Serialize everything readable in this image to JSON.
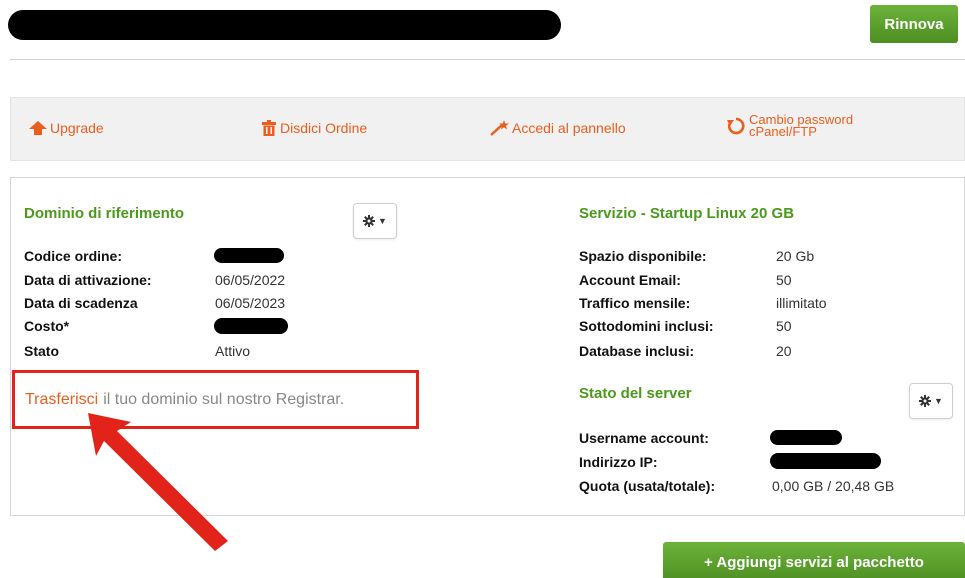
{
  "header": {
    "title_redacted": "redacted",
    "renew_label": "Rinnova"
  },
  "actions": {
    "upgrade": "Upgrade",
    "cancel_order": "Disdici Ordine",
    "panel_access": "Accedi al pannello",
    "password_line1": "Cambio password",
    "password_line2": "cPanel/FTP"
  },
  "domain_section": {
    "title": "Dominio di riferimento",
    "order_code_label": "Codice ordine:",
    "activation_label": "Data di attivazione:",
    "activation_value": "06/05/2022",
    "expiry_label": "Data di scadenza",
    "expiry_value": "06/05/2023",
    "cost_label": "Costo*",
    "status_label": "Stato",
    "status_value": "Attivo"
  },
  "transfer": {
    "link": "Trasferisci",
    "text": "il tuo dominio sul nostro Registrar."
  },
  "service_section": {
    "title": "Servizio - Startup Linux 20 GB",
    "rows": [
      {
        "label": "Spazio disponibile:",
        "value": "20 Gb"
      },
      {
        "label": "Account Email:",
        "value": "50"
      },
      {
        "label": "Traffico mensile:",
        "value": "illimitato"
      },
      {
        "label": "Sottodomini inclusi:",
        "value": "50"
      },
      {
        "label": "Database inclusi:",
        "value": "20"
      }
    ]
  },
  "server_section": {
    "title": "Stato del server",
    "username_label": "Username account:",
    "ip_label": "Indirizzo IP:",
    "quota_label": "Quota (usata/totale):",
    "quota_value": "0,00 GB / 20,48 GB"
  },
  "footer": {
    "add_services_label": "+ Aggiungi servizi al pacchetto"
  },
  "colors": {
    "accent_green": "#4a9a1c",
    "button_green": "#5ea22d",
    "link_orange": "#e85f1e",
    "highlight_red": "#e2231a"
  },
  "icons": [
    "arrow-up-icon",
    "trash-icon",
    "magic-wand-icon",
    "refresh-icon",
    "gear-icon",
    "caret-down-icon"
  ]
}
